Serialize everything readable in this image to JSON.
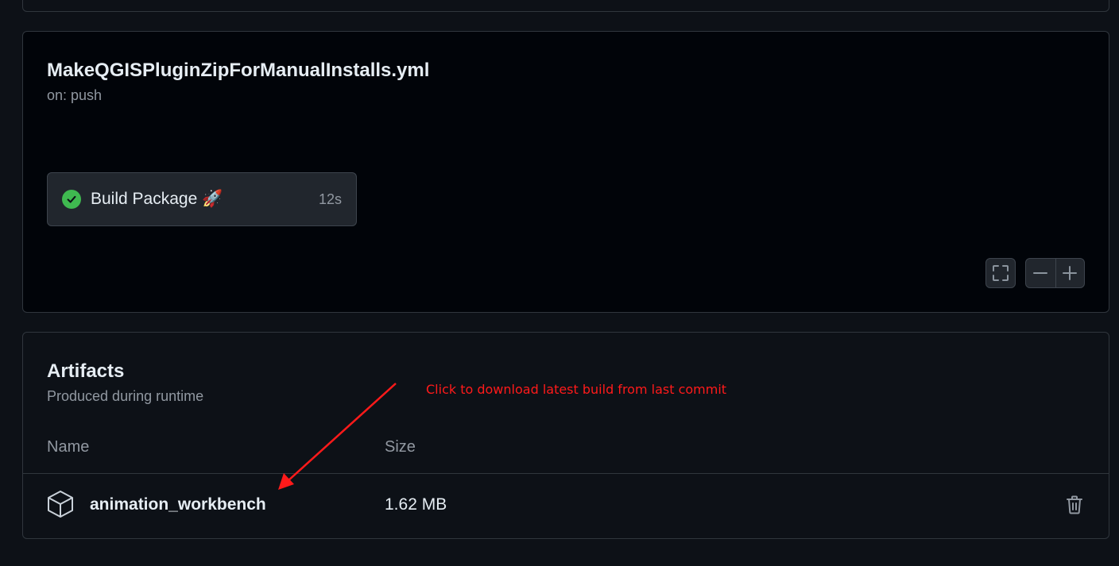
{
  "workflow": {
    "file_name": "MakeQGISPluginZipForManualInstalls.yml",
    "trigger": "on: push"
  },
  "job": {
    "name": "Build Package 🚀",
    "duration": "12s",
    "status": "success",
    "status_icon": "check-circle-icon"
  },
  "graph_controls": {
    "fullscreen_icon": "fullscreen-icon",
    "zoom_out_icon": "minus-icon",
    "zoom_in_icon": "plus-icon"
  },
  "artifacts": {
    "title": "Artifacts",
    "subtitle": "Produced during runtime",
    "columns": {
      "name": "Name",
      "size": "Size"
    },
    "items": [
      {
        "name": "animation_workbench",
        "size": "1.62 MB",
        "icon": "package-icon",
        "action_icon": "trash-icon"
      }
    ]
  },
  "annotation": {
    "text": "Click to download latest build from last commit",
    "color": "#ff1a1a"
  },
  "colors": {
    "success": "#3fb950",
    "background": "#0d1117",
    "graph_background": "#010409"
  }
}
